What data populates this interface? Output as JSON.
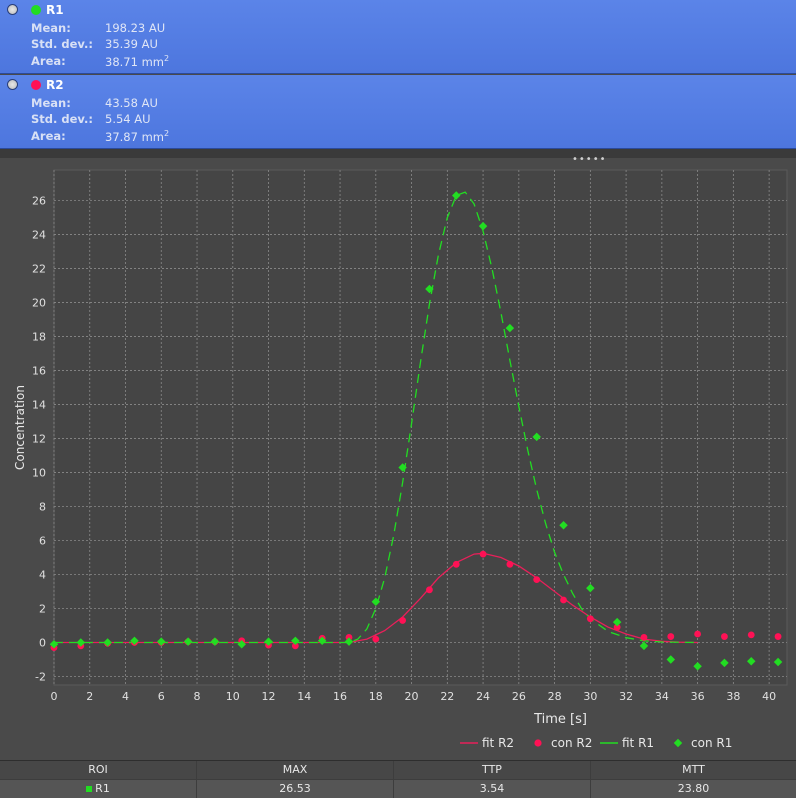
{
  "rois": [
    {
      "name": "R1",
      "color": "#22dd22",
      "mean_label": "Mean:",
      "mean": "198.23 AU",
      "std_label": "Std. dev.:",
      "std": "35.39 AU",
      "area_label": "Area:",
      "area": "38.71",
      "area_unit": "mm",
      "area_exp": "2"
    },
    {
      "name": "R2",
      "color": "#ff1155",
      "mean_label": "Mean:",
      "mean": "43.58 AU",
      "std_label": "Std. dev.:",
      "std": "5.54 AU",
      "area_label": "Area:",
      "area": "37.87",
      "area_unit": "mm",
      "area_exp": "2"
    }
  ],
  "grip": "•••••",
  "chart_data": {
    "type": "line",
    "xlabel": "Time [s]",
    "ylabel": "Concentration",
    "xlim": [
      0,
      41
    ],
    "ylim": [
      -2.5,
      27.8
    ],
    "x_ticks": [
      0,
      2,
      4,
      6,
      8,
      10,
      12,
      14,
      16,
      18,
      20,
      22,
      24,
      26,
      28,
      30,
      32,
      34,
      36,
      38,
      40
    ],
    "y_ticks": [
      -2,
      0,
      2,
      4,
      6,
      8,
      10,
      12,
      14,
      16,
      18,
      20,
      22,
      24,
      26
    ],
    "grid": true,
    "legend_position": "bottom-right",
    "series": [
      {
        "name": "fit R2",
        "kind": "line",
        "color": "#e8205a",
        "x": [
          0,
          16.5,
          17.5,
          18.5,
          19.5,
          20.5,
          21.5,
          22.5,
          23.5,
          24,
          25,
          26,
          27,
          28,
          29,
          30,
          31,
          32,
          33,
          34,
          35,
          36
        ],
        "y": [
          0,
          0,
          0.2,
          0.7,
          1.5,
          2.6,
          3.8,
          4.7,
          5.2,
          5.25,
          5.0,
          4.5,
          3.8,
          3.0,
          2.2,
          1.5,
          0.9,
          0.5,
          0.2,
          0.07,
          0.02,
          0
        ]
      },
      {
        "name": "con R2",
        "kind": "scatter",
        "color": "#ff1155",
        "x": [
          0,
          1.5,
          3,
          4.5,
          6,
          7.5,
          9,
          10.5,
          12,
          13.5,
          15,
          16.5,
          18,
          19.5,
          21,
          22.5,
          24,
          25.5,
          27,
          28.5,
          30,
          31.5,
          33,
          34.5,
          36,
          37.5,
          39,
          40.5
        ],
        "y": [
          -0.3,
          -0.2,
          -0.05,
          0.0,
          0.0,
          0.05,
          0.05,
          0.1,
          -0.15,
          -0.2,
          0.25,
          0.3,
          0.2,
          1.3,
          3.1,
          4.6,
          5.2,
          4.6,
          3.7,
          2.5,
          1.4,
          0.9,
          0.3,
          0.35,
          0.5,
          0.35,
          0.45,
          0.35
        ]
      },
      {
        "name": "fit R1",
        "kind": "line",
        "dashed": true,
        "color": "#22dd22",
        "x": [
          0,
          16.5,
          17,
          17.5,
          18,
          18.5,
          19,
          19.5,
          20,
          20.5,
          21,
          21.5,
          22,
          22.5,
          23,
          23.5,
          24,
          24.5,
          25,
          25.5,
          26,
          26.5,
          27,
          27.5,
          28,
          28.5,
          29,
          29.5,
          30,
          31,
          32,
          33,
          34,
          35,
          36
        ],
        "y": [
          0,
          0,
          0.2,
          0.8,
          2.0,
          3.8,
          6.3,
          9.4,
          12.9,
          16.5,
          19.9,
          22.8,
          25.0,
          26.3,
          26.5,
          25.8,
          24.2,
          22.0,
          19.4,
          16.6,
          13.9,
          11.3,
          9.0,
          7.0,
          5.3,
          4.0,
          2.9,
          2.0,
          1.4,
          0.65,
          0.28,
          0.1,
          0.03,
          0.01,
          0
        ]
      },
      {
        "name": "con R1",
        "kind": "scatter",
        "color": "#22dd22",
        "x": [
          0,
          1.5,
          3,
          4.5,
          6,
          7.5,
          9,
          10.5,
          12,
          13.5,
          15,
          16.5,
          18,
          19.5,
          21,
          22.5,
          24,
          25.5,
          27,
          28.5,
          30,
          31.5,
          33,
          34.5,
          36,
          37.5,
          39,
          40.5
        ],
        "y": [
          -0.1,
          0.0,
          0.0,
          0.1,
          0.05,
          0.05,
          0.05,
          -0.1,
          0.05,
          0.1,
          0.1,
          0.05,
          2.4,
          10.3,
          20.8,
          26.3,
          24.5,
          18.5,
          12.1,
          6.9,
          3.2,
          1.2,
          -0.2,
          -1.0,
          -1.4,
          -1.2,
          -1.1,
          -1.15
        ]
      }
    ]
  },
  "table": {
    "headers": [
      "ROI",
      "MAX",
      "TTP",
      "MTT"
    ],
    "rows": [
      {
        "roi": "R1",
        "roi_color": "#22dd22",
        "max": "26.53",
        "ttp": "3.54",
        "mtt": "23.80"
      }
    ]
  }
}
